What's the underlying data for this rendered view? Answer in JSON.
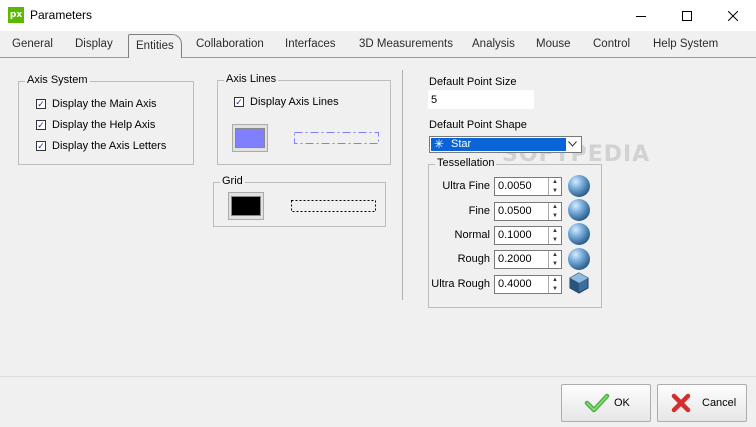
{
  "window": {
    "title": "Parameters",
    "app_icon_text": "px"
  },
  "tabs": [
    {
      "label": "General"
    },
    {
      "label": "Display"
    },
    {
      "label": "Entities",
      "active": true
    },
    {
      "label": "Collaboration"
    },
    {
      "label": "Interfaces"
    },
    {
      "label": "3D Measurements"
    },
    {
      "label": "Analysis"
    },
    {
      "label": "Mouse"
    },
    {
      "label": "Control"
    },
    {
      "label": "Help System"
    }
  ],
  "axis_system": {
    "title": "Axis System",
    "options": [
      {
        "label": "Display the Main Axis",
        "checked": true
      },
      {
        "label": "Display the Help Axis",
        "checked": true
      },
      {
        "label": "Display the Axis Letters",
        "checked": true
      }
    ]
  },
  "axis_lines": {
    "title": "Axis Lines",
    "display_label": "Display Axis Lines",
    "checked": true,
    "color": "#8080ff"
  },
  "grid": {
    "title": "Grid",
    "color": "#000000"
  },
  "point": {
    "size_label": "Default Point Size",
    "size_value": "5",
    "shape_label": "Default Point Shape",
    "shape_value": "Star",
    "shape_icon": "asterisk"
  },
  "tessellation": {
    "title": "Tessellation",
    "rows": [
      {
        "label": "Ultra Fine",
        "value": "0.0050"
      },
      {
        "label": "Fine",
        "value": "0.0500"
      },
      {
        "label": "Normal",
        "value": "0.1000"
      },
      {
        "label": "Rough",
        "value": "0.2000"
      },
      {
        "label": "Ultra Rough",
        "value": "0.4000"
      }
    ]
  },
  "watermark": "SOFTPEDIA",
  "buttons": {
    "ok": "OK",
    "cancel": "Cancel"
  },
  "colors": {
    "selection": "#0a64d8",
    "ok_check": "#4caf50",
    "cancel_x": "#d32f2f"
  }
}
